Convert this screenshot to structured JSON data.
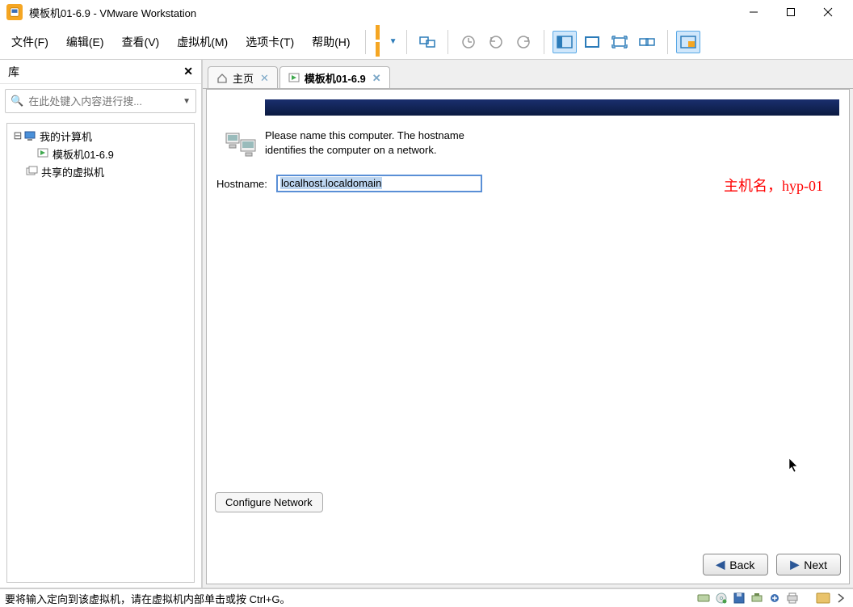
{
  "window": {
    "title": "模板机01-6.9 - VMware Workstation"
  },
  "menu": {
    "file": "文件(F)",
    "edit": "编辑(E)",
    "view": "查看(V)",
    "vm": "虚拟机(M)",
    "tabs": "选项卡(T)",
    "help": "帮助(H)"
  },
  "sidebar": {
    "title": "库",
    "search_placeholder": "在此处键入内容进行搜...",
    "nodes": {
      "my_computer": "我的计算机",
      "vm1": "模板机01-6.9",
      "shared": "共享的虚拟机"
    }
  },
  "tabs": {
    "home": "主页",
    "vm": "模板机01-6.9"
  },
  "installer": {
    "prompt": "Please name this computer.  The hostname identifies the computer on a network.",
    "hostname_label": "Hostname:",
    "hostname_value": "localhost.localdomain",
    "configure_network": "Configure Network",
    "back": "Back",
    "next": "Next"
  },
  "annotation": "主机名，hyp-01",
  "status": {
    "message": "要将输入定向到该虚拟机，请在虚拟机内部单击或按 Ctrl+G。"
  }
}
